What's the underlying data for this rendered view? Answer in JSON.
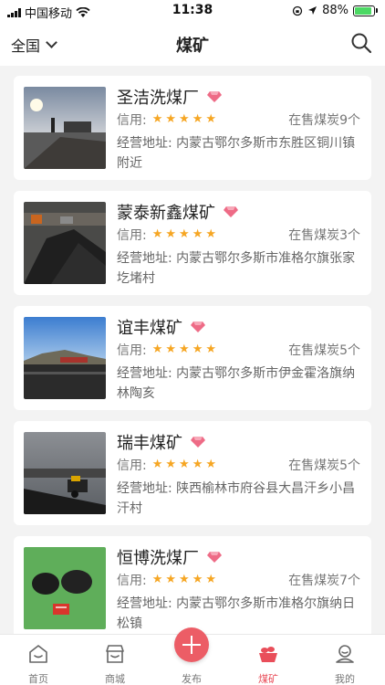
{
  "status_bar": {
    "carrier": "中国移动",
    "time": "11:38",
    "battery": "88%",
    "battery_level": 0.88
  },
  "header": {
    "region": "全国",
    "title": "煤矿"
  },
  "mines": [
    {
      "name": "圣洁洗煤厂",
      "credit_label": "信用:",
      "rating": 5,
      "stock": "在售煤炭9个",
      "address": "经营地址: 内蒙古鄂尔多斯市东胜区铜川镇附近"
    },
    {
      "name": "蒙泰新鑫煤矿",
      "credit_label": "信用:",
      "rating": 5,
      "stock": "在售煤炭3个",
      "address": "经营地址: 内蒙古鄂尔多斯市准格尔旗张家圪堵村"
    },
    {
      "name": "谊丰煤矿",
      "credit_label": "信用:",
      "rating": 5,
      "stock": "在售煤炭5个",
      "address": "经营地址: 内蒙古鄂尔多斯市伊金霍洛旗纳林陶亥"
    },
    {
      "name": "瑞丰煤矿",
      "credit_label": "信用:",
      "rating": 5,
      "stock": "在售煤炭5个",
      "address": "经营地址: 陕西榆林市府谷县大昌汗乡小昌汗村"
    },
    {
      "name": "恒博洗煤厂",
      "credit_label": "信用:",
      "rating": 5,
      "stock": "在售煤炭7个",
      "address": "经营地址: 内蒙古鄂尔多斯市准格尔旗纳日松镇"
    }
  ],
  "tabs": {
    "home": "首页",
    "mall": "商城",
    "publish": "发布",
    "mine": "煤矿",
    "me": "我的"
  },
  "colors": {
    "accent": "#e94e5a",
    "star": "#f6a623",
    "gem": "#ee6b86"
  }
}
